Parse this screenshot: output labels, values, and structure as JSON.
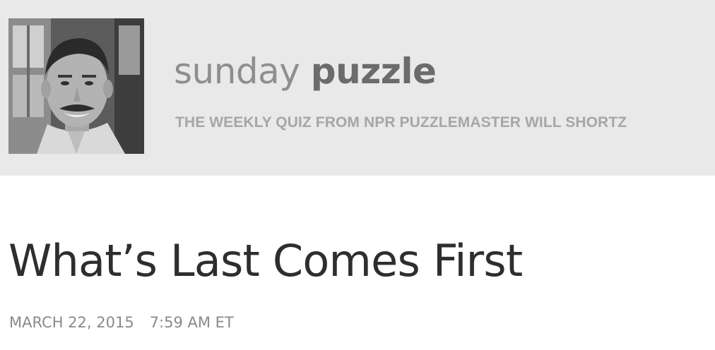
{
  "banner": {
    "series_light": "sunday ",
    "series_bold": "puzzle",
    "subtitle": "THE WEEKLY QUIZ FROM NPR PUZZLEMASTER WILL SHORTZ",
    "background": "#e9e9e9"
  },
  "article": {
    "headline": "What’s Last Comes First",
    "date": "MARCH 22, 2015",
    "time": "7:59 AM ET"
  }
}
